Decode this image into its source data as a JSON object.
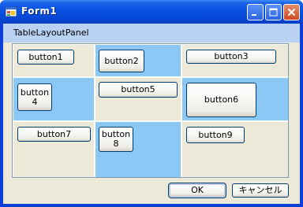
{
  "window": {
    "title": "Form1"
  },
  "panel": {
    "label": "TableLayoutPanel"
  },
  "grid": {
    "buttons": [
      "button1",
      "button2",
      "button3",
      "button4",
      "button5",
      "button6",
      "button7",
      "button8",
      "button9"
    ]
  },
  "dialog": {
    "ok_label": "OK",
    "cancel_label": "キャンセル"
  },
  "icons": {
    "app": "form-app-icon",
    "minimize": "minimize-icon",
    "maximize": "maximize-icon",
    "close": "close-icon"
  },
  "colors": {
    "titlebar": "#0a54e3",
    "client": "#ece9d8",
    "cell_blue": "#8cc8f5",
    "panel_label_bg": "#b9d1f3"
  }
}
